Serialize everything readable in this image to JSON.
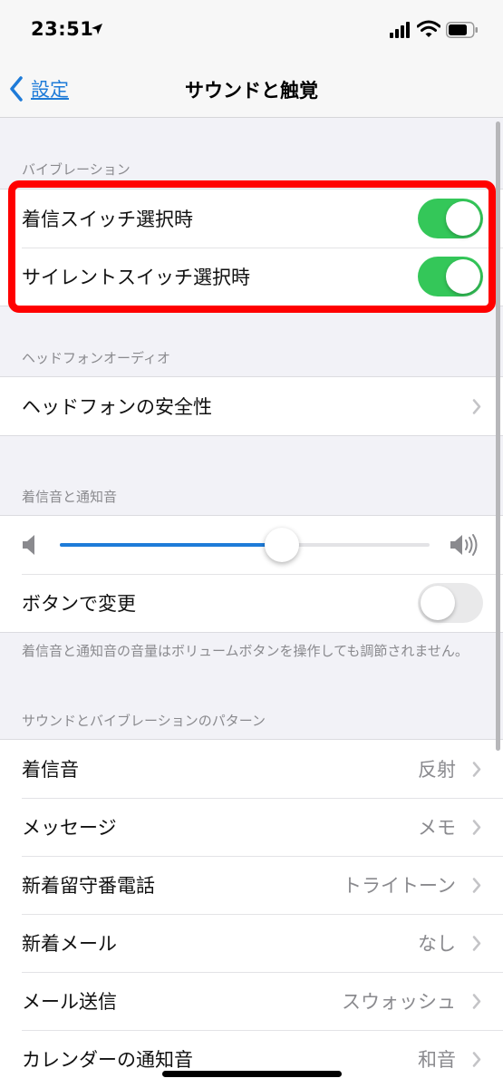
{
  "status_bar": {
    "time": "23:51"
  },
  "nav": {
    "back_label": "設定",
    "title": "サウンドと触覚"
  },
  "vibration": {
    "header": "バイブレーション",
    "items": [
      {
        "label": "着信スイッチ選択時",
        "on": true
      },
      {
        "label": "サイレントスイッチ選択時",
        "on": true
      }
    ]
  },
  "headphone_audio": {
    "header": "ヘッドフォンオーディオ",
    "items": [
      {
        "label": "ヘッドフォンの安全性"
      }
    ]
  },
  "ringer": {
    "header": "着信音と通知音",
    "volume_fraction": 0.6,
    "change_with_buttons": {
      "label": "ボタンで変更",
      "on": false
    },
    "footnote": "着信音と通知音の音量はボリュームボタンを操作しても調節されません。"
  },
  "patterns": {
    "header": "サウンドとバイブレーションのパターン",
    "items": [
      {
        "label": "着信音",
        "value": "反射"
      },
      {
        "label": "メッセージ",
        "value": "メモ"
      },
      {
        "label": "新着留守番電話",
        "value": "トライトーン"
      },
      {
        "label": "新着メール",
        "value": "なし"
      },
      {
        "label": "メール送信",
        "value": "スウォッシュ"
      },
      {
        "label": "カレンダーの通知音",
        "value": "和音"
      }
    ]
  },
  "colors": {
    "accent": "#1e7bd8",
    "toggle_on": "#34c759",
    "highlight": "#ff0000"
  }
}
